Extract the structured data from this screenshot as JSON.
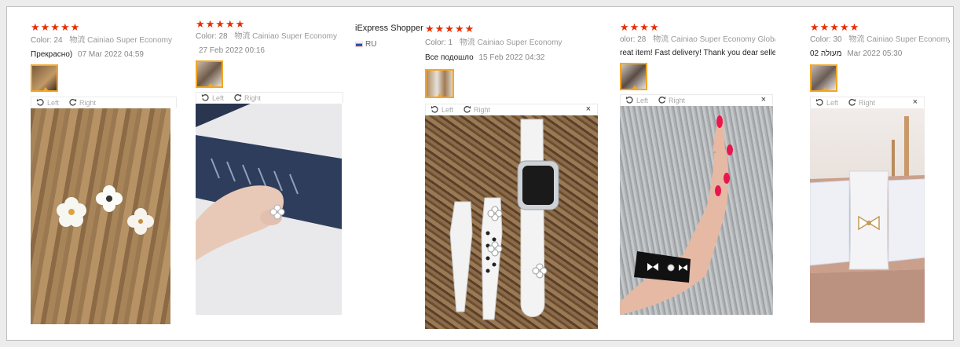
{
  "colors": {
    "star": "#e62e04",
    "thumb_border": "#f5a623",
    "toolbar_text": "#aaaaaa"
  },
  "toolbar_labels": {
    "left": "Left",
    "right": "Right",
    "close": "×"
  },
  "reviews": [
    {
      "stars": "★★★★★",
      "color_label": "Color:",
      "color_value": "24",
      "shipping": "物流 Cainiao Super Economy",
      "text": "Прекрасно)",
      "date": "07 Mar 2022 04:59"
    },
    {
      "stars": "★★★★★",
      "color_label": "Color:",
      "color_value": "28",
      "shipping": "物流 Cainiao Super Economy",
      "text": "",
      "date": "27 Feb 2022 00:16"
    },
    {
      "shopper": "iExpress Shopper",
      "country": "RU",
      "stars": "★★★★★",
      "color_label": "Color:",
      "color_value": "1",
      "shipping": "物流 Cainiao Super Economy",
      "text": "Все подошло",
      "date": "15 Feb 2022 04:32"
    },
    {
      "stars": "★★★★",
      "color_label": "olor:",
      "color_value": "28",
      "shipping": "物流 Cainiao Super Economy Global",
      "text": "reat item! Fast delivery! Thank you dear seller!",
      "date": ""
    },
    {
      "stars": "★★★★★",
      "color_label": "Color:",
      "color_value": "30",
      "shipping": "物流 Cainiao Super Economy",
      "text": "מעולה 02",
      "date": "Mar 2022 05:30"
    }
  ]
}
